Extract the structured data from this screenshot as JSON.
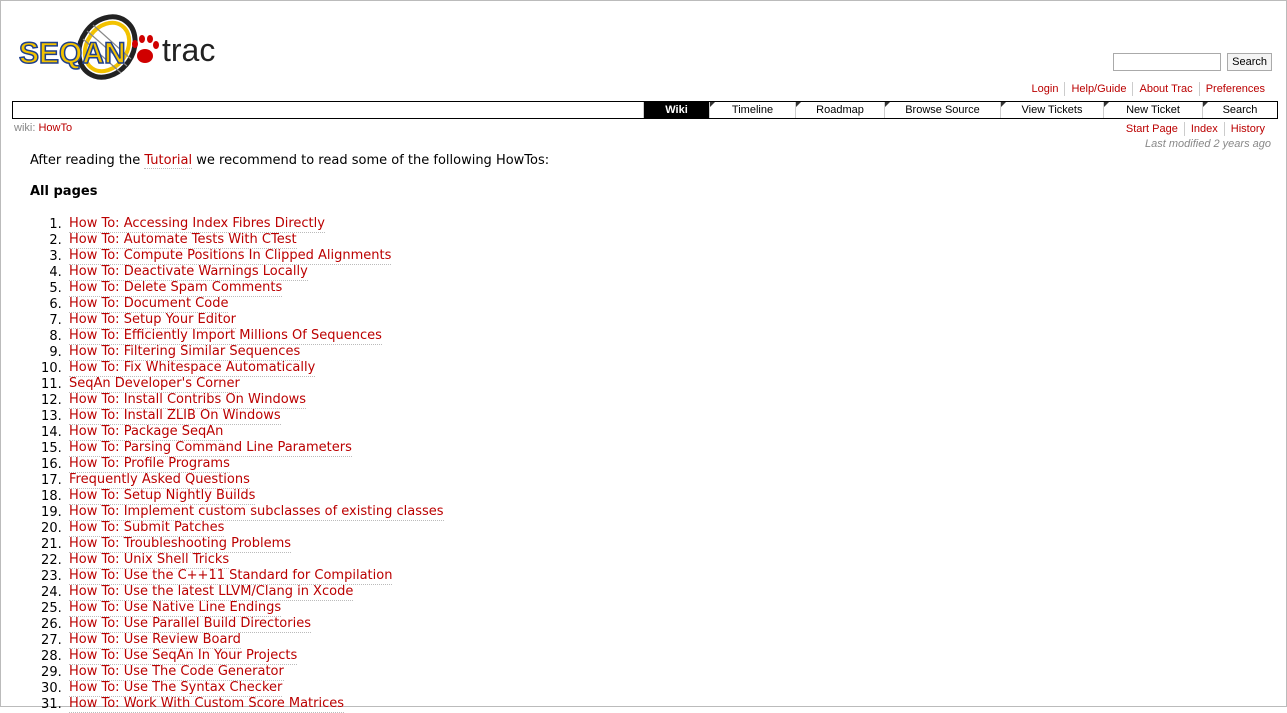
{
  "logo": {
    "text_seq": "SEQAN",
    "text_trac": "trac"
  },
  "search": {
    "placeholder": "",
    "button": "Search"
  },
  "metanav": [
    "Login",
    "Help/Guide",
    "About Trac",
    "Preferences"
  ],
  "mainnav": [
    {
      "label": "Wiki",
      "active": true
    },
    {
      "label": "Timeline",
      "active": false
    },
    {
      "label": "Roadmap",
      "active": false
    },
    {
      "label": "Browse Source",
      "active": false
    },
    {
      "label": "View Tickets",
      "active": false
    },
    {
      "label": "New Ticket",
      "active": false
    },
    {
      "label": "Search",
      "active": false
    }
  ],
  "breadcrumb": {
    "prefix": "wiki:",
    "page": "HowTo"
  },
  "ctxnav": [
    "Start Page",
    "Index",
    "History"
  ],
  "last_modified": "Last modified 2 years ago",
  "intro": {
    "before": "After reading the ",
    "link": "Tutorial",
    "after": " we recommend to read some of the following HowTos:"
  },
  "heading": "All pages",
  "pages": [
    "How To: Accessing Index Fibres Directly",
    "How To: Automate Tests With CTest",
    "How To: Compute Positions In Clipped Alignments",
    "How To: Deactivate Warnings Locally",
    "How To: Delete Spam Comments",
    "How To: Document Code",
    "How To: Setup Your Editor",
    "How To: Efficiently Import Millions Of Sequences",
    "How To: Filtering Similar Sequences",
    "How To: Fix Whitespace Automatically",
    "SeqAn Developer's Corner",
    "How To: Install Contribs On Windows",
    "How To: Install ZLIB On Windows",
    "How To: Package SeqAn",
    "How To: Parsing Command Line Parameters",
    "How To: Profile Programs",
    "Frequently Asked Questions",
    "How To: Setup Nightly Builds",
    "How To: Implement custom subclasses of existing classes",
    "How To: Submit Patches",
    "How To: Troubleshooting Problems",
    "How To: Unix Shell Tricks",
    "How To: Use the C++11 Standard for Compilation",
    "How To: Use the latest LLVM/Clang in Xcode",
    "How To: Use Native Line Endings",
    "How To: Use Parallel Build Directories",
    "How To: Use Review Board",
    "How To: Use SeqAn In Your Projects",
    "How To: Use The Code Generator",
    "How To: Use The Syntax Checker",
    "How To: Work With Custom Score Matrices"
  ],
  "colors": {
    "link": "#bb0000",
    "logo_yellow": "#f2c200",
    "logo_blue": "#1e3f8c"
  }
}
